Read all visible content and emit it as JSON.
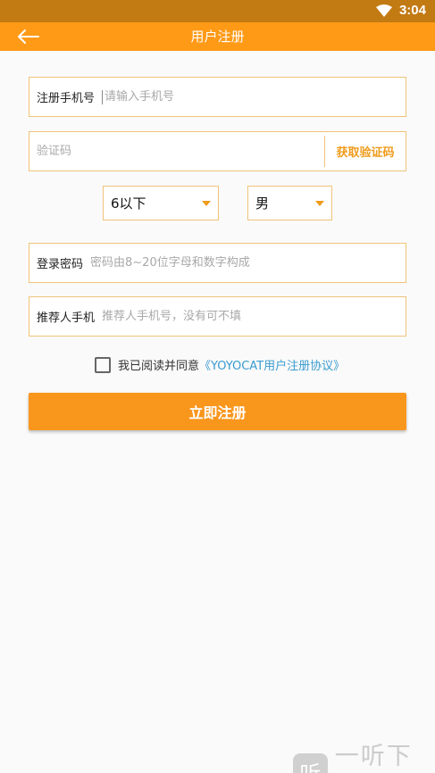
{
  "status_bar": {
    "time": "3:04"
  },
  "app_bar": {
    "title": "用户注册"
  },
  "form": {
    "phone": {
      "label": "注册手机号",
      "placeholder": "请输入手机号"
    },
    "code": {
      "placeholder": "验证码",
      "button": "获取验证码"
    },
    "age_select": {
      "value": "6以下"
    },
    "gender_select": {
      "value": "男"
    },
    "password": {
      "label": "登录密码",
      "placeholder": "密码由8~20位字母和数字构成"
    },
    "referrer": {
      "label": "推荐人手机",
      "placeholder": "推荐人手机号，没有可不填"
    }
  },
  "agreement": {
    "text": "我已阅读并同意",
    "link": "《YOYOCAT用户注册协议》"
  },
  "submit": {
    "label": "立即注册"
  },
  "watermark": {
    "logo": "听",
    "text": "一听下载"
  },
  "colors": {
    "primary": "#ff9a17",
    "status_bar": "#c27a12",
    "field_border": "#f0c37a",
    "link": "#3a9bd0"
  }
}
